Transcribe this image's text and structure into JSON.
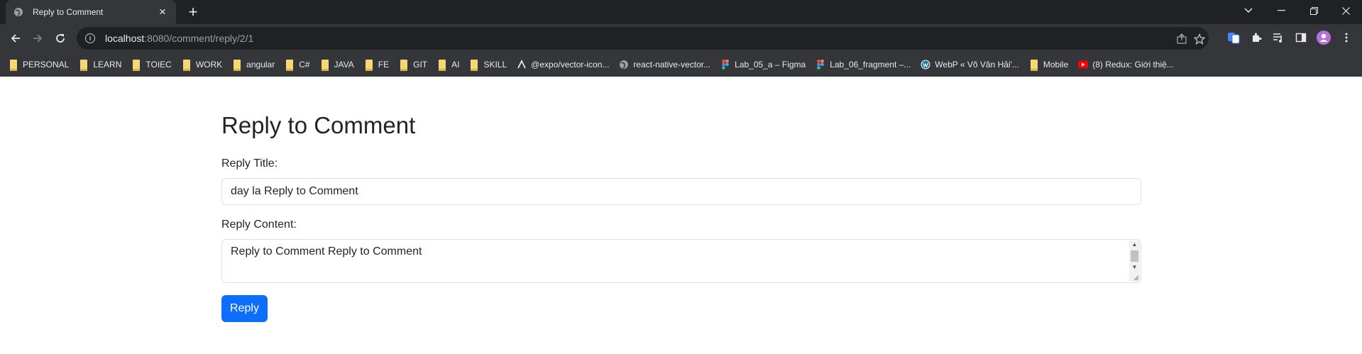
{
  "browser": {
    "tab_title": "Reply to Comment",
    "url_host": "localhost",
    "url_rest": ":8080/comment/reply/2/1",
    "bookmarks": [
      {
        "label": "PERSONAL",
        "icon": "folder-icon"
      },
      {
        "label": "LEARN",
        "icon": "folder-icon"
      },
      {
        "label": "TOIEC",
        "icon": "folder-icon"
      },
      {
        "label": "WORK",
        "icon": "folder-icon"
      },
      {
        "label": "angular",
        "icon": "folder-icon"
      },
      {
        "label": "C#",
        "icon": "folder-icon"
      },
      {
        "label": "JAVA",
        "icon": "folder-icon"
      },
      {
        "label": "FE",
        "icon": "folder-icon"
      },
      {
        "label": "GIT",
        "icon": "folder-icon"
      },
      {
        "label": "AI",
        "icon": "folder-icon"
      },
      {
        "label": "SKILL",
        "icon": "folder-icon"
      },
      {
        "label": "@expo/vector-icon...",
        "icon": "expo-icon"
      },
      {
        "label": "react-native-vector...",
        "icon": "globe-icon"
      },
      {
        "label": "Lab_05_a – Figma",
        "icon": "figma-icon"
      },
      {
        "label": "Lab_06_fragment –...",
        "icon": "figma-icon"
      },
      {
        "label": "WebP « Võ Văn Hải'...",
        "icon": "wordpress-icon"
      },
      {
        "label": "Mobile",
        "icon": "folder-icon"
      },
      {
        "label": "(8) Redux: Giới thiệ...",
        "icon": "youtube-icon"
      }
    ]
  },
  "page": {
    "title": "Reply to Comment",
    "reply_title_label": "Reply Title:",
    "reply_title_value": "day la Reply to Comment",
    "reply_content_label": "Reply Content:",
    "reply_content_value": "Reply to Comment Reply to Comment",
    "submit_label": "Reply"
  },
  "colors": {
    "primary": "#0d6efd",
    "chrome_dark": "#202124",
    "chrome_toolbar": "#35363a"
  }
}
